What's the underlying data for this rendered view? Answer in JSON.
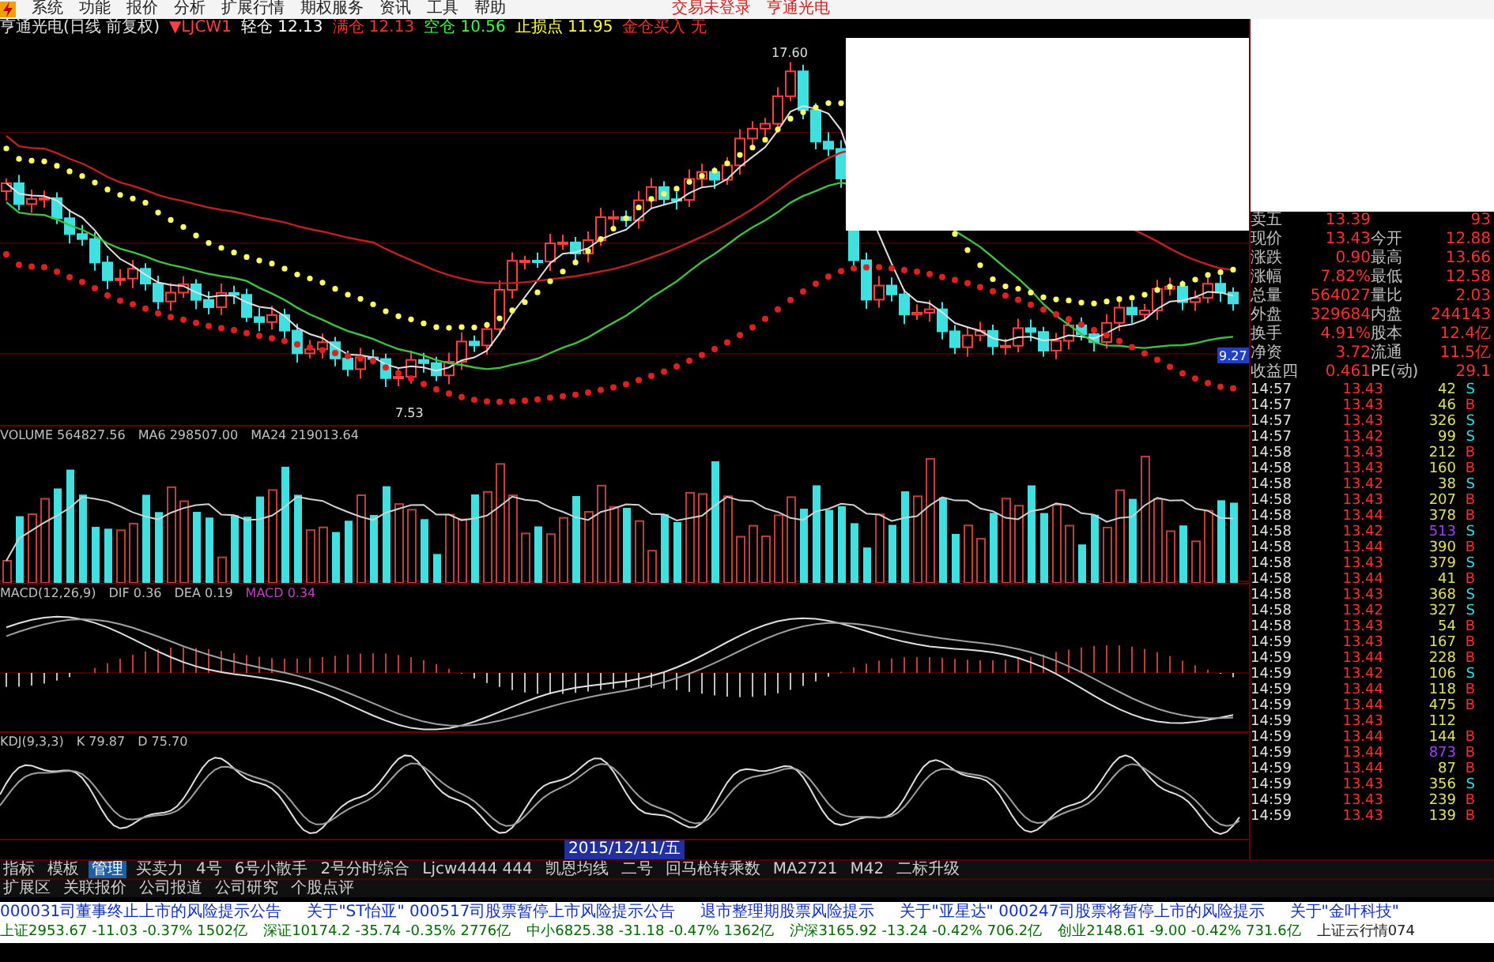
{
  "menu": {
    "items": [
      "系统",
      "功能",
      "报价",
      "分析",
      "扩展行情",
      "期权服务",
      "资讯",
      "工具",
      "帮助"
    ],
    "right": [
      "交易未登录",
      "亨通光电"
    ]
  },
  "info_line": {
    "title": "亨通光电(日线 前复权)",
    "indicator": "▼LJCW1",
    "values": [
      {
        "label": "轻仓",
        "value": "12.13",
        "color": "#ffffff"
      },
      {
        "label": "满仓",
        "value": "12.13",
        "color": "#ff3030"
      },
      {
        "label": "空仓",
        "value": "10.56",
        "color": "#40ff40"
      },
      {
        "label": "止损点",
        "value": "11.95",
        "color": "#ffff40"
      },
      {
        "label": "金仓买入",
        "value": "无",
        "color": "#ff3030"
      }
    ]
  },
  "price_chart": {
    "high_label": "17.60",
    "low_label": "7.53",
    "side_label": "9.27"
  },
  "volume": {
    "parts": [
      {
        "text": "VOLUME 564827.56",
        "color": "#c0c0c0"
      },
      {
        "text": "MA6 298507.00",
        "color": "#c0c0c0"
      },
      {
        "text": "MA24 219013.64",
        "color": "#c0c0c0"
      }
    ]
  },
  "macd": {
    "parts": [
      {
        "text": "MACD(12,26,9)",
        "color": "#c0c0c0"
      },
      {
        "text": "DIF 0.36",
        "color": "#c0c0c0"
      },
      {
        "text": "DEA 0.19",
        "color": "#c0c0c0"
      },
      {
        "text": "MACD 0.34",
        "color": "#c040c0"
      }
    ]
  },
  "kdj": {
    "parts": [
      {
        "text": "KDJ(9,3,3)",
        "color": "#c0c0c0"
      },
      {
        "text": "K 79.87",
        "color": "#c0c0c0"
      },
      {
        "text": "D 75.70",
        "color": "#c0c0c0"
      }
    ]
  },
  "date_label": "2015/12/11/五",
  "quote": {
    "rows": [
      {
        "label": "卖五",
        "value": "13.39",
        "value2": "93"
      },
      {
        "label": "现价",
        "value": "13.43",
        "label2": "今开",
        "value2": "12.88"
      },
      {
        "label": "涨跌",
        "value": "0.90",
        "label2": "最高",
        "value2": "13.66"
      },
      {
        "label": "涨幅",
        "value": "7.82%",
        "label2": "最低",
        "value2": "12.58"
      },
      {
        "label": "总量",
        "value": "564027",
        "label2": "量比",
        "value2": "2.03"
      },
      {
        "label": "外盘",
        "value": "329684",
        "label2": "内盘",
        "value2": "244143"
      },
      {
        "label": "换手",
        "value": "4.91%",
        "label2": "股本",
        "value2": "12.4亿"
      },
      {
        "label": "净资",
        "value": "3.72",
        "label2": "流通",
        "value2": "11.5亿"
      },
      {
        "label": "收益四",
        "value": "0.461",
        "label2": "PE(动)",
        "value2": "29.1"
      }
    ]
  },
  "ticks": [
    {
      "time": "14:57",
      "price": "13.43",
      "volume": "42",
      "side": "S",
      "big": false
    },
    {
      "time": "14:57",
      "price": "13.43",
      "volume": "46",
      "side": "B",
      "big": false
    },
    {
      "time": "14:57",
      "price": "13.43",
      "volume": "326",
      "side": "S",
      "big": false
    },
    {
      "time": "14:57",
      "price": "13.42",
      "volume": "99",
      "side": "S",
      "big": false
    },
    {
      "time": "14:58",
      "price": "13.43",
      "volume": "212",
      "side": "B",
      "big": false
    },
    {
      "time": "14:58",
      "price": "13.43",
      "volume": "160",
      "side": "B",
      "big": false
    },
    {
      "time": "14:58",
      "price": "13.42",
      "volume": "38",
      "side": "S",
      "big": false
    },
    {
      "time": "14:58",
      "price": "13.43",
      "volume": "207",
      "side": "B",
      "big": false
    },
    {
      "time": "14:58",
      "price": "13.44",
      "volume": "378",
      "side": "B",
      "big": false
    },
    {
      "time": "14:58",
      "price": "13.42",
      "volume": "513",
      "side": "S",
      "big": true
    },
    {
      "time": "14:58",
      "price": "13.44",
      "volume": "390",
      "side": "B",
      "big": false
    },
    {
      "time": "14:58",
      "price": "13.43",
      "volume": "379",
      "side": "S",
      "big": false
    },
    {
      "time": "14:58",
      "price": "13.44",
      "volume": "41",
      "side": "B",
      "big": false
    },
    {
      "time": "14:58",
      "price": "13.43",
      "volume": "368",
      "side": "S",
      "big": false
    },
    {
      "time": "14:58",
      "price": "13.42",
      "volume": "327",
      "side": "S",
      "big": false
    },
    {
      "time": "14:58",
      "price": "13.43",
      "volume": "54",
      "side": "B",
      "big": false
    },
    {
      "time": "14:59",
      "price": "13.43",
      "volume": "167",
      "side": "B",
      "big": false
    },
    {
      "time": "14:59",
      "price": "13.44",
      "volume": "228",
      "side": "B",
      "big": false
    },
    {
      "time": "14:59",
      "price": "13.42",
      "volume": "106",
      "side": "S",
      "big": false
    },
    {
      "time": "14:59",
      "price": "13.44",
      "volume": "118",
      "side": "B",
      "big": false
    },
    {
      "time": "14:59",
      "price": "13.44",
      "volume": "475",
      "side": "B",
      "big": false
    },
    {
      "time": "14:59",
      "price": "13.43",
      "volume": "112",
      "big": false
    },
    {
      "time": "14:59",
      "price": "13.44",
      "volume": "144",
      "side": "B",
      "big": false
    },
    {
      "time": "14:59",
      "price": "13.44",
      "volume": "873",
      "side": "B",
      "big": true
    },
    {
      "time": "14:59",
      "price": "13.44",
      "volume": "87",
      "side": "B",
      "big": false
    },
    {
      "time": "14:59",
      "price": "13.43",
      "volume": "356",
      "side": "S",
      "big": false
    },
    {
      "time": "14:59",
      "price": "13.43",
      "volume": "239",
      "side": "B",
      "big": false
    },
    {
      "time": "14:59",
      "price": "13.43",
      "volume": "139",
      "side": "B",
      "big": false
    }
  ],
  "bottom_tabs": [
    {
      "label": "指标",
      "selected": false
    },
    {
      "label": "模板",
      "selected": false
    },
    {
      "label": "管理",
      "selected": true
    },
    {
      "label": "买卖力",
      "selected": false
    },
    {
      "label": "4号",
      "selected": false
    },
    {
      "label": "6号小散手",
      "selected": false
    },
    {
      "label": "2号分时综合",
      "selected": false
    },
    {
      "label": "Ljcw4444 444",
      "selected": false
    },
    {
      "label": "凯恩均线",
      "selected": false
    },
    {
      "label": "二号",
      "selected": false
    },
    {
      "label": "回马枪转乘数",
      "selected": false
    },
    {
      "label": "MA2721",
      "selected": false
    },
    {
      "label": "M42",
      "selected": false
    },
    {
      "label": "二标升级",
      "selected": false
    }
  ],
  "bottom_tabs_2": [
    "扩展区",
    "关联报价",
    "公司报道",
    "公司研究",
    "个股点评"
  ],
  "news": [
    "000031司董事终止上市的风险提示公告",
    "关于\"ST怡亚\" 000517司股票暂停上市风险提示公告",
    "退市整理期股票风险提示",
    "关于\"亚星达\" 000247司股票将暂停上市的风险提示",
    "关于\"金叶科技\""
  ],
  "status": [
    {
      "text": "上证2953.67 -11.03 -0.37% 1502亿",
      "color": "#006a00"
    },
    {
      "text": "深证10174.2 -35.74 -0.35% 2776亿",
      "color": "#006a00"
    },
    {
      "text": "中小6825.38 -31.18 -0.47% 1362亿",
      "color": "#006a00"
    },
    {
      "text": "沪深3165.92 -13.24 -0.42% 706.2亿",
      "color": "#006a00"
    },
    {
      "text": "创业2148.61 -9.00 -0.42% 731.6亿",
      "color": "#006a00"
    },
    {
      "text": "上证云行情074",
      "color": "#202020"
    }
  ]
}
